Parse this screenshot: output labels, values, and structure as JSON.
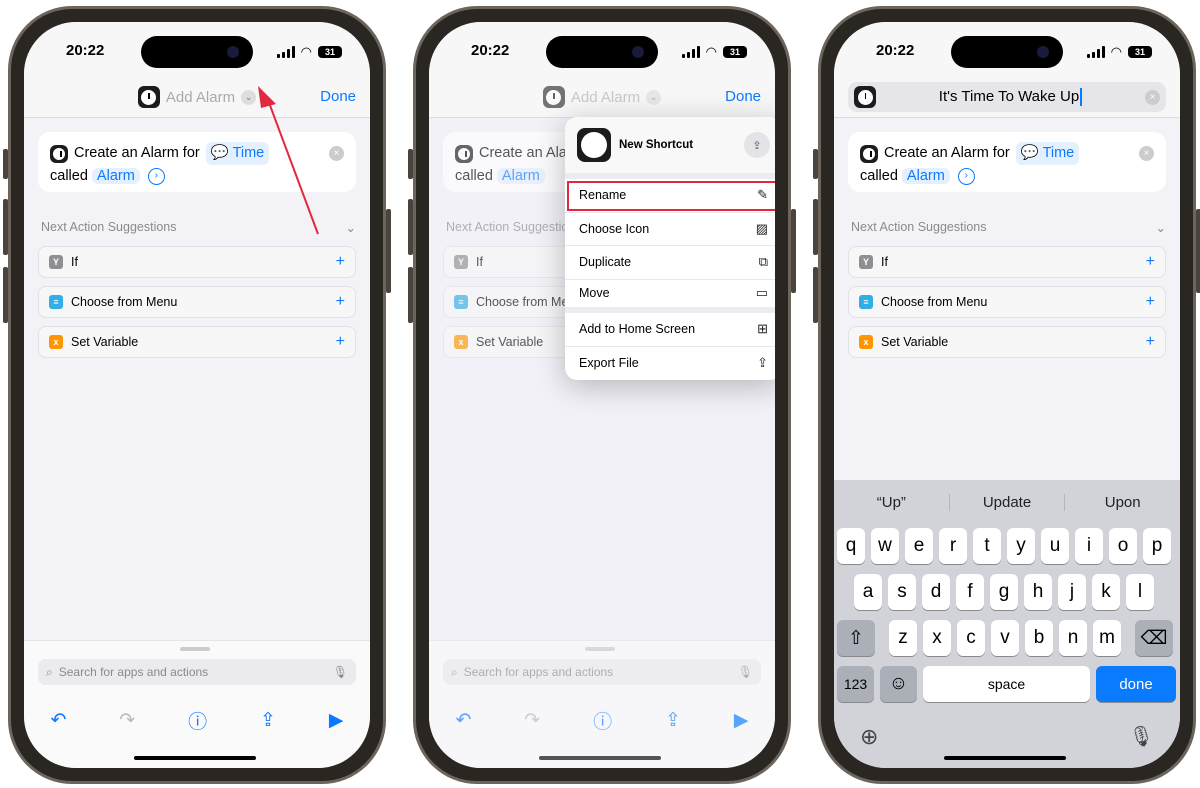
{
  "status": {
    "time": "20:22",
    "battery": "31"
  },
  "nav": {
    "title": "Add Alarm",
    "done": "Done"
  },
  "action": {
    "create_text": "Create an Alarm for",
    "time_token": "Time",
    "called_text": "called",
    "alarm_token": "Alarm"
  },
  "suggestions": {
    "header": "Next Action Suggestions",
    "items": [
      {
        "label": "If",
        "color": "#8e8e93",
        "icon": "Y"
      },
      {
        "label": "Choose from Menu",
        "color": "#32ade6",
        "icon": "≡"
      },
      {
        "label": "Set Variable",
        "color": "#ff9500",
        "icon": "x"
      }
    ]
  },
  "search": {
    "placeholder": "Search for apps and actions"
  },
  "menu": {
    "title": "New Shortcut",
    "items": [
      "Rename",
      "Choose Icon",
      "Duplicate",
      "Move",
      "Add to Home Screen",
      "Export File"
    ]
  },
  "rename": {
    "value": "It's Time To Wake Up"
  },
  "keyboard": {
    "predictions": [
      "“Up”",
      "Update",
      "Upon"
    ],
    "row1": [
      "q",
      "w",
      "e",
      "r",
      "t",
      "y",
      "u",
      "i",
      "o",
      "p"
    ],
    "row2": [
      "a",
      "s",
      "d",
      "f",
      "g",
      "h",
      "j",
      "k",
      "l"
    ],
    "row3": [
      "z",
      "x",
      "c",
      "v",
      "b",
      "n",
      "m"
    ],
    "numbers": "123",
    "space": "space",
    "done": "done"
  },
  "colors": {
    "accent": "#0a7aff",
    "highlight": "#e0293f"
  }
}
